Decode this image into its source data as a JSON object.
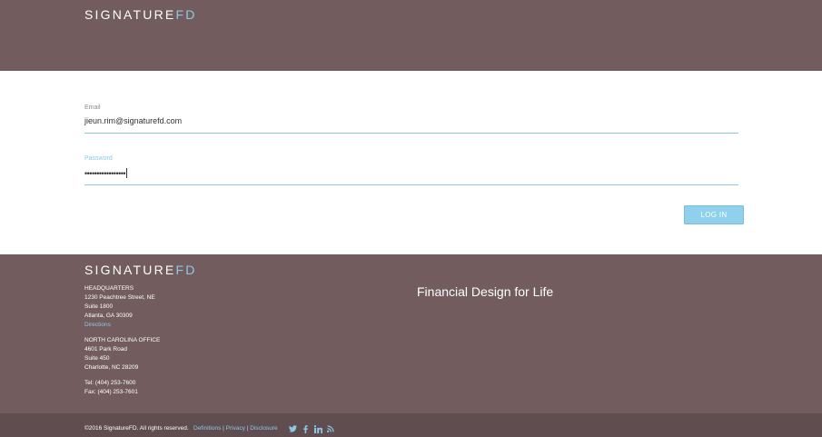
{
  "header": {
    "logo_main": "SIGNATURE",
    "logo_accent": "FD"
  },
  "form": {
    "email_label": "Email",
    "email_value": "jieun.rim@signaturefd.com",
    "password_label": "Password",
    "password_value": "•••••••••••••••••",
    "login_label": "LOG IN"
  },
  "footer": {
    "logo_main": "SIGNATURE",
    "logo_accent": "FD",
    "tagline": "Financial Design for Life",
    "hq": {
      "title": "HEADQUARTERS",
      "line1": "1230 Peachtree Street, NE",
      "line2": "Suite 1800",
      "line3": "Atlanta, GA 30309",
      "directions": "Directions"
    },
    "nc": {
      "title": "NORTH CAROLINA OFFICE",
      "line1": "4601 Park Road",
      "line2": "Suite 450",
      "line3": "Charlotte, NC 28209"
    },
    "tel": "Tel: (404) 253-7600",
    "fax": "Fax: (404) 253-7601"
  },
  "bottom": {
    "copyright": "©2016 SignatureFD. All rights reserved.",
    "definitions": "Definitions",
    "privacy": "Privacy",
    "disclosure": "Disclosure",
    "sep1": " | ",
    "sep2": " | "
  },
  "social_icons": [
    "twitter-icon",
    "facebook-icon",
    "linkedin-icon",
    "rss-icon"
  ],
  "colors": {
    "brand_brown": "#725c5e",
    "bottom_bar": "#5f4d4f",
    "accent_blue": "#8dc9e6",
    "button_blue": "#8fd0ec"
  }
}
